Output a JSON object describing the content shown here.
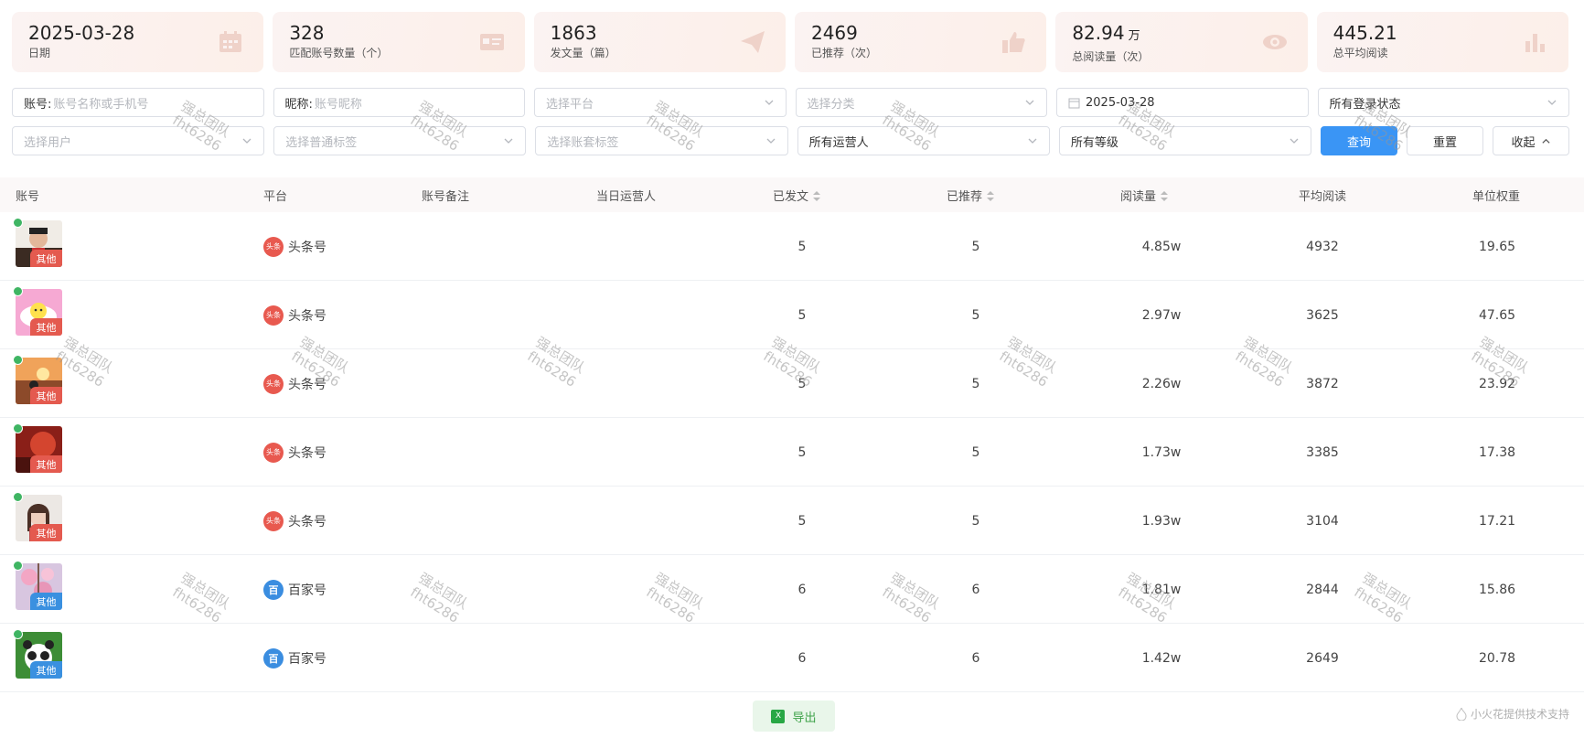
{
  "stats": [
    {
      "value": "2025-03-28",
      "unit": "",
      "label": "日期",
      "icon": "calendar-icon"
    },
    {
      "value": "328",
      "unit": "",
      "label": "匹配账号数量（个）",
      "icon": "id-card-icon"
    },
    {
      "value": "1863",
      "unit": "",
      "label": "发文量（篇）",
      "icon": "paper-plane-icon"
    },
    {
      "value": "2469",
      "unit": "",
      "label": "已推荐（次）",
      "icon": "thumbs-up-icon"
    },
    {
      "value": "82.94",
      "unit": "万",
      "label": "总阅读量（次）",
      "icon": "eye-icon"
    },
    {
      "value": "445.21",
      "unit": "",
      "label": "总平均阅读",
      "icon": "bar-chart-icon"
    }
  ],
  "filters": {
    "account_label": "账号:",
    "account_placeholder": "账号名称或手机号",
    "nickname_label": "昵称:",
    "nickname_placeholder": "账号昵称",
    "platform_placeholder": "选择平台",
    "category_placeholder": "选择分类",
    "date_value": "2025-03-28",
    "login_status_value": "所有登录状态",
    "user_placeholder": "选择用户",
    "tag_placeholder": "选择普通标签",
    "package_tag_placeholder": "选择账套标签",
    "operator_value": "所有运营人",
    "level_value": "所有等级",
    "query_label": "查询",
    "reset_label": "重置",
    "collapse_label": "收起"
  },
  "table": {
    "headers": {
      "account": "账号",
      "platform": "平台",
      "note": "账号备注",
      "operator": "当日运营人",
      "posts": "已发文",
      "recommended": "已推荐",
      "reads": "阅读量",
      "avg_reads": "平均阅读",
      "weight": "单位权重"
    },
    "rows": [
      {
        "tag": "其他",
        "tag_color": "#e45a4f",
        "avatar_bg": "#8b5a3c",
        "platform": "头条号",
        "platform_icon": "头条",
        "posts": "5",
        "recommended": "5",
        "reads": "4.85w",
        "avg_reads": "4932",
        "weight": "19.65"
      },
      {
        "tag": "其他",
        "tag_color": "#e45a4f",
        "avatar_bg": "#f4a8d0",
        "platform": "头条号",
        "platform_icon": "头条",
        "posts": "5",
        "recommended": "5",
        "reads": "2.97w",
        "avg_reads": "3625",
        "weight": "47.65"
      },
      {
        "tag": "其他",
        "tag_color": "#e45a4f",
        "avatar_bg": "#d9844a",
        "platform": "头条号",
        "platform_icon": "头条",
        "posts": "5",
        "recommended": "5",
        "reads": "2.26w",
        "avg_reads": "3872",
        "weight": "23.92"
      },
      {
        "tag": "其他",
        "tag_color": "#e45a4f",
        "avatar_bg": "#b33a2a",
        "platform": "头条号",
        "platform_icon": "头条",
        "posts": "5",
        "recommended": "5",
        "reads": "1.73w",
        "avg_reads": "3385",
        "weight": "17.38"
      },
      {
        "tag": "其他",
        "tag_color": "#e45a4f",
        "avatar_bg": "#d8d0c8",
        "platform": "头条号",
        "platform_icon": "头条",
        "posts": "5",
        "recommended": "5",
        "reads": "1.93w",
        "avg_reads": "3104",
        "weight": "17.21"
      },
      {
        "tag": "其他",
        "tag_color": "#3a90e0",
        "avatar_bg": "#d9b8c8",
        "platform": "百家号",
        "platform_icon": "百",
        "posts": "6",
        "recommended": "6",
        "reads": "1.81w",
        "avg_reads": "2844",
        "weight": "15.86"
      },
      {
        "tag": "其他",
        "tag_color": "#3a90e0",
        "avatar_bg": "#3f8f3a",
        "platform": "百家号",
        "platform_icon": "百",
        "posts": "6",
        "recommended": "6",
        "reads": "1.42w",
        "avg_reads": "2649",
        "weight": "20.78"
      }
    ]
  },
  "export_label": "导出",
  "export_icon": "X",
  "footer_text": "小火花提供技术支持",
  "watermark": {
    "line1": "强总团队",
    "line2": "fht6286"
  }
}
